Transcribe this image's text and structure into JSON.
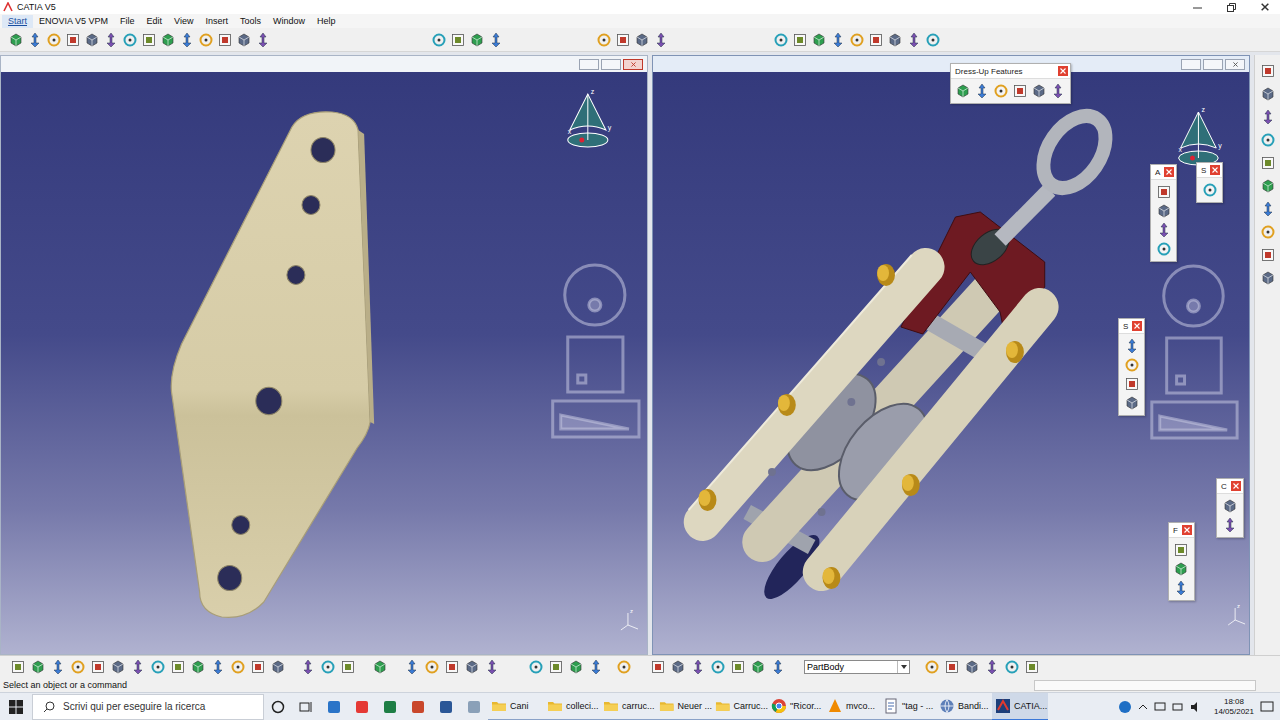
{
  "window": {
    "title": "CATIA V5"
  },
  "menu": [
    {
      "label": "Start",
      "selected": true
    },
    {
      "label": "ENOVIA V5 VPM",
      "selected": false
    },
    {
      "label": "File",
      "selected": false
    },
    {
      "label": "Edit",
      "selected": false
    },
    {
      "label": "View",
      "selected": false
    },
    {
      "label": "Insert",
      "selected": false
    },
    {
      "label": "Tools",
      "selected": false
    },
    {
      "label": "Window",
      "selected": false
    },
    {
      "label": "Help",
      "selected": false
    }
  ],
  "viewports": [
    {
      "name": "plate",
      "active": false
    },
    {
      "name": "pulley-assembly",
      "active": true
    }
  ],
  "axis_labels": {
    "x": "x",
    "y": "y",
    "z": "z"
  },
  "floating_toolbars": [
    {
      "title": "Dress-Up Features",
      "kind": "wide",
      "icons": 6
    },
    {
      "title": "A",
      "kind": "tall",
      "icons": 4
    },
    {
      "title": "S",
      "kind": "tall",
      "icons": 1
    },
    {
      "title": "S",
      "kind": "tall",
      "icons": 4
    },
    {
      "title": "C",
      "kind": "tall",
      "icons": 2
    },
    {
      "title": "F",
      "kind": "tall",
      "icons": 3
    }
  ],
  "bottom_toolbar": {
    "dropdown": "PartBody"
  },
  "status_bar": "Select an object or a command",
  "taskbar": {
    "search": "Scrivi qui per eseguire la ricerca",
    "apps": [
      {
        "label": "Cani",
        "kind": "folder",
        "selected": false
      },
      {
        "label": "colleci...",
        "kind": "folder",
        "selected": false
      },
      {
        "label": "carruc...",
        "kind": "folder",
        "selected": false
      },
      {
        "label": "Neuer ...",
        "kind": "folder",
        "selected": false
      },
      {
        "label": "Carruc...",
        "kind": "folder",
        "selected": false
      },
      {
        "label": "\"Ricor...",
        "kind": "chrome",
        "selected": false
      },
      {
        "label": "mvco...",
        "kind": "vlc",
        "selected": false
      },
      {
        "label": "\"tag - ...",
        "kind": "doc",
        "selected": false
      },
      {
        "label": "Bandi...",
        "kind": "globe",
        "selected": false
      },
      {
        "label": "CATIA...",
        "kind": "catia",
        "selected": true
      }
    ],
    "time": "18:08",
    "date": "14/05/2021"
  }
}
